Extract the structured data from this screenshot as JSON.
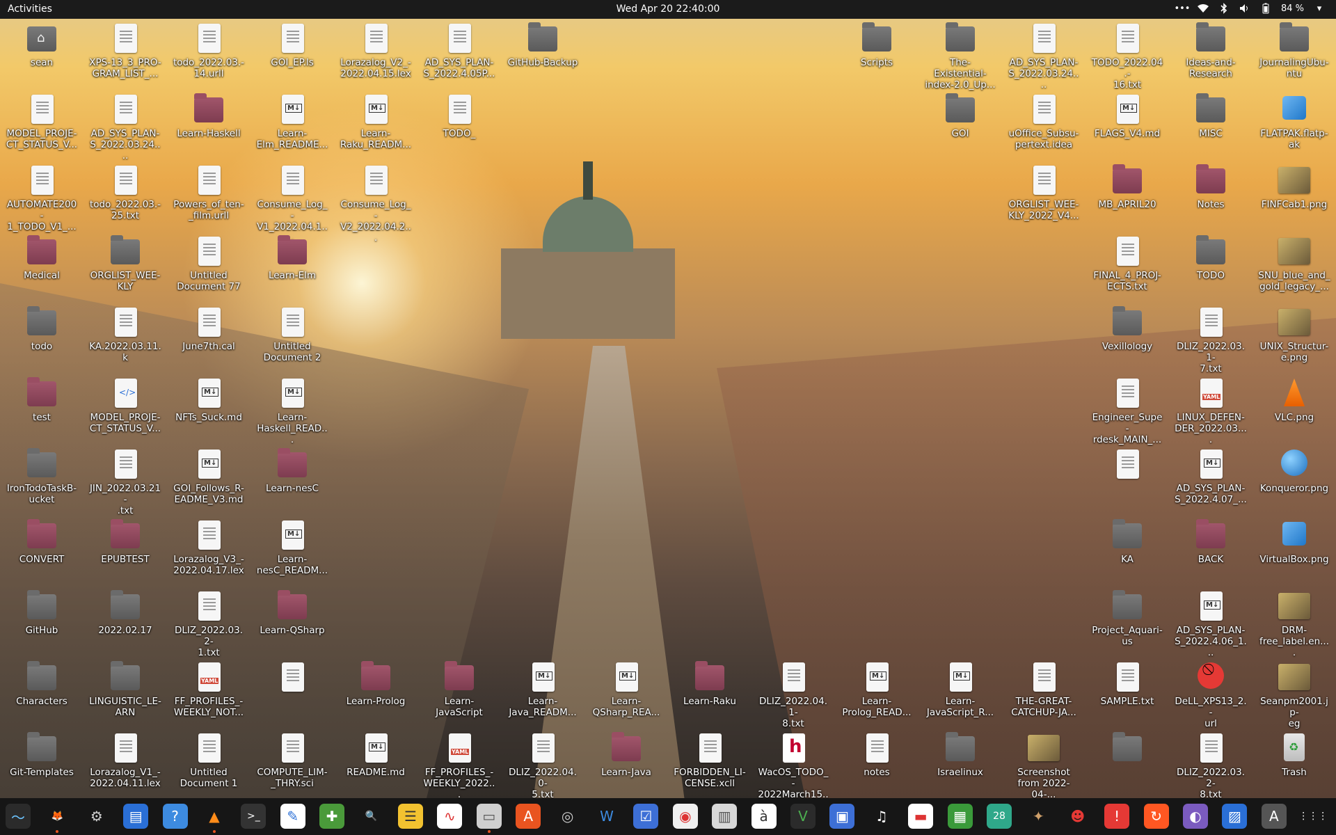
{
  "topbar": {
    "activities": "Activities",
    "clock": "Wed Apr 20  22:40:00",
    "battery": "84 %"
  },
  "desktop_icons": [
    {
      "label": "sean",
      "type": "home",
      "col": 0,
      "row": 0
    },
    {
      "label": "XPS-13_3_PRO-\nGRAM_LIST_...",
      "type": "doc",
      "col": 1,
      "row": 0
    },
    {
      "label": "todo_2022.03.-\n14.urll",
      "type": "doc",
      "col": 2,
      "row": 0
    },
    {
      "label": "GOI_EP.ls",
      "type": "doc",
      "col": 3,
      "row": 0
    },
    {
      "label": "Lorazalog_V2_-\n2022.04.15.lex",
      "type": "doc",
      "col": 4,
      "row": 0
    },
    {
      "label": "AD_SYS_PLAN-\nS_2022.4.05P...",
      "type": "doc",
      "col": 5,
      "row": 0
    },
    {
      "label": "GitHub-Backup",
      "type": "folder",
      "col": 6,
      "row": 0
    },
    {
      "label": "Scripts",
      "type": "folder",
      "col": 10,
      "row": 0
    },
    {
      "label": "The-Existential-\nindex-2.0_Up...",
      "type": "folder",
      "col": 11,
      "row": 0
    },
    {
      "label": "AD_SYS_PLAN-\nS_2022.03.24....",
      "type": "doc",
      "col": 12,
      "row": 0
    },
    {
      "label": "TODO_2022.04.-\n16.txt",
      "type": "doc",
      "col": 13,
      "row": 0
    },
    {
      "label": "Ideas-and-\nResearch",
      "type": "folder",
      "col": 14,
      "row": 0
    },
    {
      "label": "JournalingUbu-\nntu",
      "type": "folder",
      "col": 15,
      "row": 0
    },
    {
      "label": "MODEL_PROJE-\nCT_STATUS_V...",
      "type": "doc",
      "col": 0,
      "row": 1
    },
    {
      "label": "AD_SYS_PLAN-\nS_2022.03.24....",
      "type": "doc",
      "col": 1,
      "row": 1
    },
    {
      "label": "Learn-Haskell",
      "type": "folder-red",
      "col": 2,
      "row": 1
    },
    {
      "label": "Learn-\nElm_README...",
      "type": "md",
      "col": 3,
      "row": 1
    },
    {
      "label": "Learn-\nRaku_READM...",
      "type": "md",
      "col": 4,
      "row": 1
    },
    {
      "label": "TODO_",
      "type": "doc",
      "col": 5,
      "row": 1
    },
    {
      "label": "GOI",
      "type": "folder",
      "col": 11,
      "row": 1
    },
    {
      "label": "uOffice_Subsu-\npertext.idea",
      "type": "doc",
      "col": 12,
      "row": 1
    },
    {
      "label": "FLAGS_V4.md",
      "type": "md",
      "col": 13,
      "row": 1
    },
    {
      "label": "MISC",
      "type": "folder",
      "col": 14,
      "row": 1
    },
    {
      "label": "FLATPAK.flatp-\nak",
      "type": "box",
      "col": 15,
      "row": 1
    },
    {
      "label": "AUTOMATE200-\n1_TODO_V1_...",
      "type": "doc",
      "col": 0,
      "row": 2
    },
    {
      "label": "todo_2022.03.-\n25.txt",
      "type": "doc",
      "col": 1,
      "row": 2
    },
    {
      "label": "Powers_of_ten-\n_film.urll",
      "type": "doc",
      "col": 2,
      "row": 2
    },
    {
      "label": "Consume_Log_-\nV1_2022.04.1...",
      "type": "doc",
      "col": 3,
      "row": 2
    },
    {
      "label": "Consume_Log_-\nV2_2022.04.2...",
      "type": "doc",
      "col": 4,
      "row": 2
    },
    {
      "label": "ORGLIST_WEE-\nKLY_2022_V4...",
      "type": "doc",
      "col": 12,
      "row": 2
    },
    {
      "label": "MB_APRIL20",
      "type": "folder-red",
      "col": 13,
      "row": 2
    },
    {
      "label": "Notes",
      "type": "folder-red",
      "col": 14,
      "row": 2
    },
    {
      "label": "FINFCab1.png",
      "type": "img",
      "col": 15,
      "row": 2
    },
    {
      "label": "Medical",
      "type": "folder-red",
      "col": 0,
      "row": 3
    },
    {
      "label": "ORGLIST_WEE-\nKLY",
      "type": "folder",
      "col": 1,
      "row": 3
    },
    {
      "label": "Untitled\nDocument 77",
      "type": "doc",
      "col": 2,
      "row": 3
    },
    {
      "label": "Learn-Elm",
      "type": "folder-red",
      "col": 3,
      "row": 3
    },
    {
      "label": "FINAL_4_PROJ-\nECTS.txt",
      "type": "doc",
      "col": 13,
      "row": 3
    },
    {
      "label": "TODO",
      "type": "folder",
      "col": 14,
      "row": 3
    },
    {
      "label": "SNU_blue_and_\ngold_legacy_...",
      "type": "img",
      "col": 15,
      "row": 3
    },
    {
      "label": "todo",
      "type": "folder",
      "col": 0,
      "row": 4
    },
    {
      "label": "KA.2022.03.11.k",
      "type": "doc",
      "col": 1,
      "row": 4
    },
    {
      "label": "June7th.cal",
      "type": "doc",
      "col": 2,
      "row": 4
    },
    {
      "label": "Untitled\nDocument 2",
      "type": "doc",
      "col": 3,
      "row": 4
    },
    {
      "label": "Vexillology",
      "type": "folder",
      "col": 13,
      "row": 4
    },
    {
      "label": "DLIZ_2022.03.1-\n7.txt",
      "type": "doc",
      "col": 14,
      "row": 4
    },
    {
      "label": "UNIX_Structur-\ne.png",
      "type": "img",
      "col": 15,
      "row": 4
    },
    {
      "label": "test",
      "type": "folder-red",
      "col": 0,
      "row": 5
    },
    {
      "label": "MODEL_PROJE-\nCT_STATUS_V...",
      "type": "html",
      "col": 1,
      "row": 5
    },
    {
      "label": "NFTs_Suck.md",
      "type": "md",
      "col": 2,
      "row": 5
    },
    {
      "label": "Learn-\nHaskell_READ...",
      "type": "md",
      "col": 3,
      "row": 5
    },
    {
      "label": "Engineer_Supe-\nrdesk_MAIN_...",
      "type": "doc",
      "col": 13,
      "row": 5
    },
    {
      "label": "LINUX_DEFEN-\nDER_2022.03....",
      "type": "yaml",
      "col": 14,
      "row": 5
    },
    {
      "label": "VLC.png",
      "type": "vlc",
      "col": 15,
      "row": 5
    },
    {
      "label": "IronTodoTaskB-\nucket",
      "type": "folder",
      "col": 0,
      "row": 6
    },
    {
      "label": "JIN_2022.03.21-\n.txt",
      "type": "doc",
      "col": 1,
      "row": 6
    },
    {
      "label": "GOI_Follows_R-\nEADME_V3.md",
      "type": "md",
      "col": 2,
      "row": 6
    },
    {
      "label": "Learn-nesC",
      "type": "folder-red",
      "col": 3,
      "row": 6
    },
    {
      "label": "",
      "type": "doc",
      "col": 13,
      "row": 6
    },
    {
      "label": "AD_SYS_PLAN-\nS_2022.4.07_...",
      "type": "md",
      "col": 14,
      "row": 6
    },
    {
      "label": "Konqueror.png",
      "type": "globe",
      "col": 15,
      "row": 6
    },
    {
      "label": "CONVERT",
      "type": "folder-red",
      "col": 0,
      "row": 7
    },
    {
      "label": "EPUBTEST",
      "type": "folder-red",
      "col": 1,
      "row": 7
    },
    {
      "label": "Lorazalog_V3_-\n2022.04.17.lex",
      "type": "doc",
      "col": 2,
      "row": 7
    },
    {
      "label": "Learn-\nnesC_READM...",
      "type": "md",
      "col": 3,
      "row": 7
    },
    {
      "label": "KA",
      "type": "folder",
      "col": 13,
      "row": 7
    },
    {
      "label": "BACK",
      "type": "folder-red",
      "col": 14,
      "row": 7
    },
    {
      "label": "VirtualBox.png",
      "type": "box",
      "col": 15,
      "row": 7
    },
    {
      "label": "GitHub",
      "type": "folder",
      "col": 0,
      "row": 8
    },
    {
      "label": "2022.02.17",
      "type": "folder",
      "col": 1,
      "row": 8
    },
    {
      "label": "DLIZ_2022.03.2-\n1.txt",
      "type": "doc",
      "col": 2,
      "row": 8
    },
    {
      "label": "Learn-QSharp",
      "type": "folder-red",
      "col": 3,
      "row": 8
    },
    {
      "label": "Project_Aquari-\nus",
      "type": "folder",
      "col": 13,
      "row": 8
    },
    {
      "label": "AD_SYS_PLAN-\nS_2022.4.06_1...",
      "type": "md",
      "col": 14,
      "row": 8
    },
    {
      "label": "DRM-\nfree_label.en....",
      "type": "img",
      "col": 15,
      "row": 8
    },
    {
      "label": "Characters",
      "type": "folder",
      "col": 0,
      "row": 9
    },
    {
      "label": "LINGUISTIC_LE-\nARN",
      "type": "folder",
      "col": 1,
      "row": 9
    },
    {
      "label": "FF_PROFILES_-\nWEEKLY_NOT...",
      "type": "yaml",
      "col": 2,
      "row": 9
    },
    {
      "label": "",
      "type": "doc",
      "col": 3,
      "row": 9
    },
    {
      "label": "Learn-Prolog",
      "type": "folder-red",
      "col": 4,
      "row": 9
    },
    {
      "label": "Learn-\nJavaScript",
      "type": "folder-red",
      "col": 5,
      "row": 9
    },
    {
      "label": "Learn-\nJava_READM...",
      "type": "md",
      "col": 6,
      "row": 9
    },
    {
      "label": "Learn-\nQSharp_REA...",
      "type": "md",
      "col": 7,
      "row": 9
    },
    {
      "label": "Learn-Raku",
      "type": "folder-red",
      "col": 8,
      "row": 9
    },
    {
      "label": "DLIZ_2022.04.1-\n8.txt",
      "type": "doc",
      "col": 9,
      "row": 9
    },
    {
      "label": "Learn-\nProlog_READ...",
      "type": "md",
      "col": 10,
      "row": 9
    },
    {
      "label": "Learn-\nJavaScript_R...",
      "type": "md",
      "col": 11,
      "row": 9
    },
    {
      "label": "THE-GREAT-\nCATCHUP-JA...",
      "type": "doc",
      "col": 12,
      "row": 9
    },
    {
      "label": "SAMPLE.txt",
      "type": "doc",
      "col": 13,
      "row": 9
    },
    {
      "label": "DeLL_XPS13_2.-\nurl",
      "type": "noentry",
      "col": 14,
      "row": 9
    },
    {
      "label": "Seanpm2001.jp-\neg",
      "type": "img",
      "col": 15,
      "row": 9
    },
    {
      "label": "Git-Templates",
      "type": "folder",
      "col": 0,
      "row": 10
    },
    {
      "label": "Lorazalog_V1_-\n2022.04.11.lex",
      "type": "doc",
      "col": 1,
      "row": 10
    },
    {
      "label": "Untitled\nDocument 1",
      "type": "doc",
      "col": 2,
      "row": 10
    },
    {
      "label": "COMPUTE_LIM-\n_THRY.sci",
      "type": "doc",
      "col": 3,
      "row": 10
    },
    {
      "label": "README.md",
      "type": "md",
      "col": 4,
      "row": 10
    },
    {
      "label": "FF_PROFILES_-\nWEEKLY_2022...",
      "type": "yaml",
      "col": 5,
      "row": 10
    },
    {
      "label": "DLIZ_2022.04.0-\n5.txt",
      "type": "doc",
      "col": 6,
      "row": 10
    },
    {
      "label": "Learn-Java",
      "type": "folder-red",
      "col": 7,
      "row": 10
    },
    {
      "label": "FORBIDDEN_LI-\nCENSE.xcll",
      "type": "doc",
      "col": 8,
      "row": 10
    },
    {
      "label": "WacOS_TODO_-\n2022March15....",
      "type": "hred",
      "col": 9,
      "row": 10
    },
    {
      "label": "notes",
      "type": "doc",
      "col": 10,
      "row": 10
    },
    {
      "label": "Israelinux",
      "type": "folder",
      "col": 11,
      "row": 10
    },
    {
      "label": "Screenshot\nfrom 2022-04-...",
      "type": "img",
      "col": 12,
      "row": 10
    },
    {
      "label": "",
      "type": "folder",
      "col": 13,
      "row": 10
    },
    {
      "label": "DLIZ_2022.03.2-\n8.txt",
      "type": "doc",
      "col": 14,
      "row": 10
    },
    {
      "label": "Trash",
      "type": "trash",
      "col": 15,
      "row": 10
    }
  ],
  "dock": [
    {
      "name": "system-monitor-icon",
      "glyph": "〜",
      "bg": "#2b2b2b",
      "fg": "#6cc4ff",
      "running": false
    },
    {
      "name": "firefox-icon",
      "glyph": "🦊",
      "bg": "transparent",
      "fg": "#ff8a1a",
      "running": true
    },
    {
      "name": "settings-icon",
      "glyph": "⚙",
      "bg": "transparent",
      "fg": "#d0d0d0",
      "running": false
    },
    {
      "name": "document-icon",
      "glyph": "▤",
      "bg": "#2a6fd6",
      "fg": "#ffffff",
      "running": false
    },
    {
      "name": "help-icon",
      "glyph": "?",
      "bg": "#3d8be0",
      "fg": "#ffffff",
      "running": false
    },
    {
      "name": "vlc-icon",
      "glyph": "▲",
      "bg": "transparent",
      "fg": "#ff8c1a",
      "running": true
    },
    {
      "name": "terminal-icon",
      "glyph": ">_",
      "bg": "#333333",
      "fg": "#ffffff",
      "running": false
    },
    {
      "name": "text-editor-icon",
      "glyph": "✎",
      "bg": "#ffffff",
      "fg": "#2a6fd6",
      "running": false
    },
    {
      "name": "extension-icon",
      "glyph": "✚",
      "bg": "#4a9a3a",
      "fg": "#ffffff",
      "running": false
    },
    {
      "name": "image-viewer-icon",
      "glyph": "🔍",
      "bg": "transparent",
      "fg": "#cccccc",
      "running": false
    },
    {
      "name": "notes-icon",
      "glyph": "☰",
      "bg": "#f2c230",
      "fg": "#333333",
      "running": false
    },
    {
      "name": "waveform-icon",
      "glyph": "∿",
      "bg": "#ffffff",
      "fg": "#d33",
      "running": false
    },
    {
      "name": "files-icon",
      "glyph": "▭",
      "bg": "#cfcfcf",
      "fg": "#555555",
      "running": true
    },
    {
      "name": "software-center-icon",
      "glyph": "A",
      "bg": "#e95420",
      "fg": "#ffffff",
      "running": false
    },
    {
      "name": "disc-icon",
      "glyph": "◎",
      "bg": "transparent",
      "fg": "#cccccc",
      "running": false
    },
    {
      "name": "writer-icon",
      "glyph": "W",
      "bg": "transparent",
      "fg": "#3d8be0",
      "running": false
    },
    {
      "name": "tasks-icon",
      "glyph": "☑",
      "bg": "#3d6fd6",
      "fg": "#ffffff",
      "running": false
    },
    {
      "name": "sticker-icon",
      "glyph": "◉",
      "bg": "#f0f0f0",
      "fg": "#d33",
      "running": false
    },
    {
      "name": "archive-icon",
      "glyph": "▥",
      "bg": "#d8d8d8",
      "fg": "#555555",
      "running": false
    },
    {
      "name": "font-icon",
      "glyph": "à",
      "bg": "#ffffff",
      "fg": "#333333",
      "running": false
    },
    {
      "name": "vim-icon",
      "glyph": "V",
      "bg": "#2b2b2b",
      "fg": "#4caf50",
      "running": false
    },
    {
      "name": "screen-icon",
      "glyph": "▣",
      "bg": "#3d6fd6",
      "fg": "#ffffff",
      "running": false
    },
    {
      "name": "music-icon",
      "glyph": "♫",
      "bg": "transparent",
      "fg": "#ffffff",
      "running": false
    },
    {
      "name": "presentation-icon",
      "glyph": "▬",
      "bg": "#ffffff",
      "fg": "#d33",
      "running": false
    },
    {
      "name": "spreadsheet-icon",
      "glyph": "▦",
      "bg": "#3a9a3a",
      "fg": "#ffffff",
      "running": false
    },
    {
      "name": "calendar-icon",
      "glyph": "28",
      "bg": "#2fa88a",
      "fg": "#ffffff",
      "running": false
    },
    {
      "name": "gimp-icon",
      "glyph": "✦",
      "bg": "transparent",
      "fg": "#cfa06a",
      "running": false
    },
    {
      "name": "mario-icon",
      "glyph": "☻",
      "bg": "transparent",
      "fg": "#e53935",
      "running": false
    },
    {
      "name": "alert-icon",
      "glyph": "!",
      "bg": "#e53935",
      "fg": "#ffffff",
      "running": false
    },
    {
      "name": "update-icon",
      "glyph": "↻",
      "bg": "#ff5722",
      "fg": "#ffffff",
      "running": false
    },
    {
      "name": "tor-icon",
      "glyph": "◐",
      "bg": "#7b5bbf",
      "fg": "#ffffff",
      "running": false
    },
    {
      "name": "photo-icon",
      "glyph": "▨",
      "bg": "#2a6fd6",
      "fg": "#ffffff",
      "running": false
    },
    {
      "name": "update-manager-icon",
      "glyph": "A",
      "bg": "#555555",
      "fg": "#ffffff",
      "running": false
    },
    {
      "name": "app-grid-icon",
      "glyph": "⋮⋮⋮",
      "bg": "transparent",
      "fg": "#ffffff",
      "running": false
    }
  ]
}
